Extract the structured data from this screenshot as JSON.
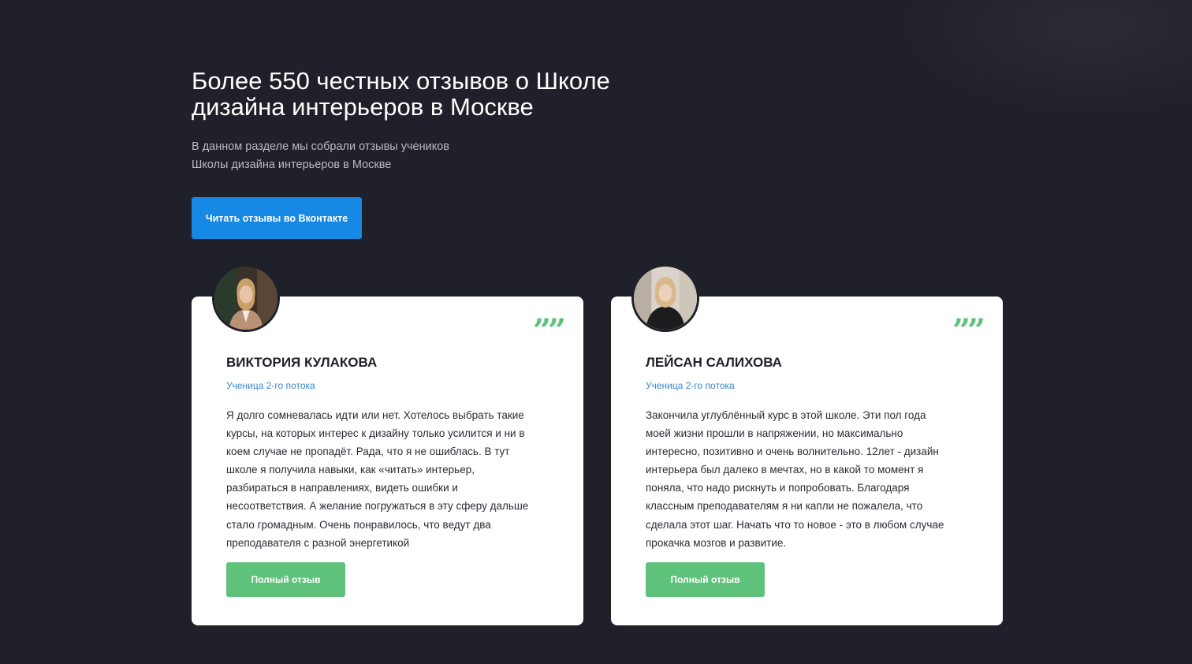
{
  "header": {
    "title": "Более 550 честных отзывов о Школе дизайна интерьеров в Москве",
    "subtitle_line1": "В данном разделе мы собрали отзывы учеников",
    "subtitle_line2": "Школы дизайна интерьеров в Москве",
    "vk_button_label": "Читать отзывы во Вконтакте"
  },
  "colors": {
    "background": "#1f2029",
    "primary_button": "#1689e5",
    "accent_green": "#5ec27a",
    "role_text": "#3a86cf"
  },
  "reviews": [
    {
      "avatar_icon": "reviewer-photo",
      "quote_icon": "quote-marks-icon",
      "quote_glyph": "”",
      "name": "ВИКТОРИЯ КУЛАКОВА",
      "role": "Ученица 2-го потока",
      "text": "Я долго сомневалась идти или нет. Хотелось выбрать такие курсы, на которых интерес к дизайну только усилится и ни в коем случае не пропадёт. Рада, что я не ошиблась. В тут школе я получила навыки, как «читать» интерьер, разбираться в направлениях, видеть ошибки и несоответствия. А желание погружаться в эту сферу дальше стало громадным. Очень понравилось, что ведут два преподавателя с разной энергетикой",
      "button_label": "Полный отзыв"
    },
    {
      "avatar_icon": "reviewer-photo",
      "quote_icon": "quote-marks-icon",
      "quote_glyph": "”",
      "name": "ЛЕЙСАН САЛИХОВА",
      "role": "Ученица 2-го потока",
      "text": "Закончила углублённый курс в этой школе. Эти пол года моей жизни прошли в напряжении, но максимально интересно, позитивно и очень волнительно. 12лет - дизайн интерьера был далеко в мечтах, но в какой то момент я поняла, что надо рискнуть и попробовать. Благодаря классным преподавателям я ни капли не пожалела, что сделала этот шаг. Начать что то новое - это в любом случае прокачка мозгов и развитие.",
      "button_label": "Полный отзыв"
    }
  ]
}
